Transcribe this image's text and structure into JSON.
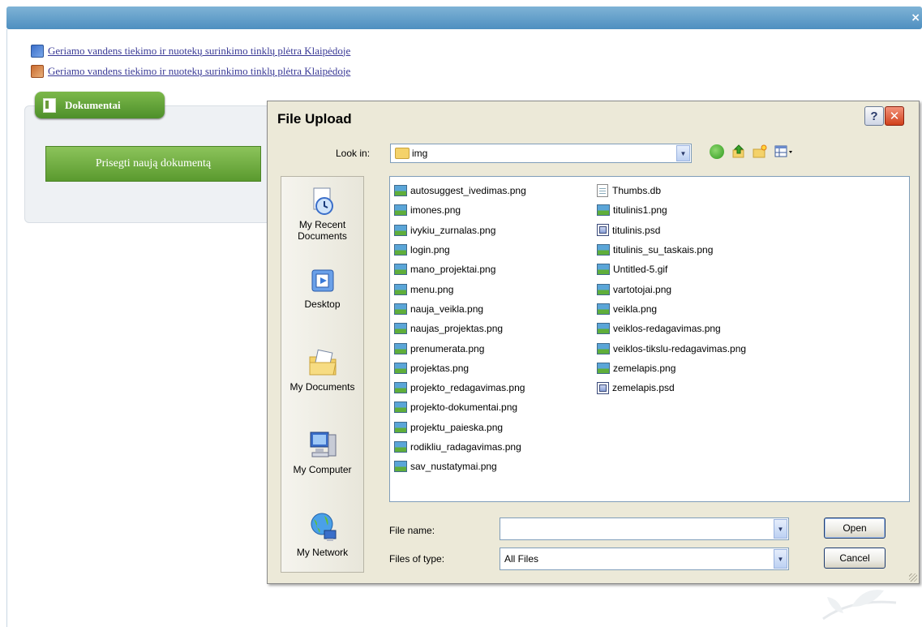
{
  "header": {
    "close_label": "×"
  },
  "links": [
    {
      "text": "Geriamo vandens tiekimo ir nuotekų surinkimo tinklų plėtra Klaipėdoje"
    },
    {
      "text": "Geriamo vandens tiekimo ir nuotekų surinkimo tinklų plėtra Klaipėdoje"
    }
  ],
  "documents": {
    "tab_label": "Dokumentai",
    "attach_button": "Prisegti naują dokumentą"
  },
  "dialog": {
    "title": "File Upload",
    "help_label": "?",
    "close_label": "✕",
    "look_in_label": "Look in:",
    "look_in_value": "img",
    "places": [
      {
        "label": "My Recent Documents",
        "icon": "recent-documents-icon"
      },
      {
        "label": "Desktop",
        "icon": "desktop-icon"
      },
      {
        "label": "My Documents",
        "icon": "my-documents-icon"
      },
      {
        "label": "My Computer",
        "icon": "my-computer-icon"
      },
      {
        "label": "My Network",
        "icon": "my-network-icon"
      }
    ],
    "files_col1": [
      "autosuggest_ivedimas.png",
      "imones.png",
      "ivykiu_zurnalas.png",
      "login.png",
      "mano_projektai.png",
      "menu.png",
      "nauja_veikla.png",
      "naujas_projektas.png",
      "prenumerata.png",
      "projektas.png",
      "projekto_redagavimas.png",
      "projekto-dokumentai.png",
      "projektu_paieska.png",
      "rodikliu_radagavimas.png",
      "sav_nustatymai.png"
    ],
    "files_col2": [
      "Thumbs.db",
      "titulinis1.png",
      "titulinis.psd",
      "titulinis_su_taskais.png",
      "Untitled-5.gif",
      "vartotojai.png",
      "veikla.png",
      "veiklos-redagavimas.png",
      "veiklos-tikslu-redagavimas.png",
      "zemelapis.png",
      "zemelapis.psd"
    ],
    "file_name_label": "File name:",
    "file_name_value": "",
    "file_type_label": "Files of type:",
    "file_type_value": "All Files",
    "open_label": "Open",
    "cancel_label": "Cancel"
  }
}
